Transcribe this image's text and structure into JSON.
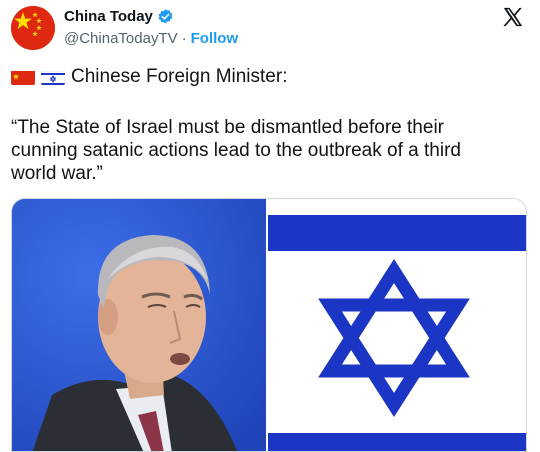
{
  "account": {
    "display_name": "China Today",
    "handle": "@ChinaTodayTV",
    "separator": "·",
    "follow_label": "Follow"
  },
  "tweet": {
    "lead_text": "Chinese Foreign Minister:",
    "quote_text": "“The State of Israel must be dismantled before their cunning satanic actions lead to the outbreak of a third world war.”"
  },
  "icons": {
    "verified": "verified-badge-icon",
    "logo": "x-logo-icon",
    "flags": [
      "china-flag-icon",
      "israel-flag-icon"
    ]
  },
  "colors": {
    "link": "#1d9bf0",
    "muted": "#536471",
    "israel_blue": "#1b35c4",
    "china_red": "#de2910",
    "china_yellow": "#ffde00",
    "photo_background": "#2d57d6"
  }
}
